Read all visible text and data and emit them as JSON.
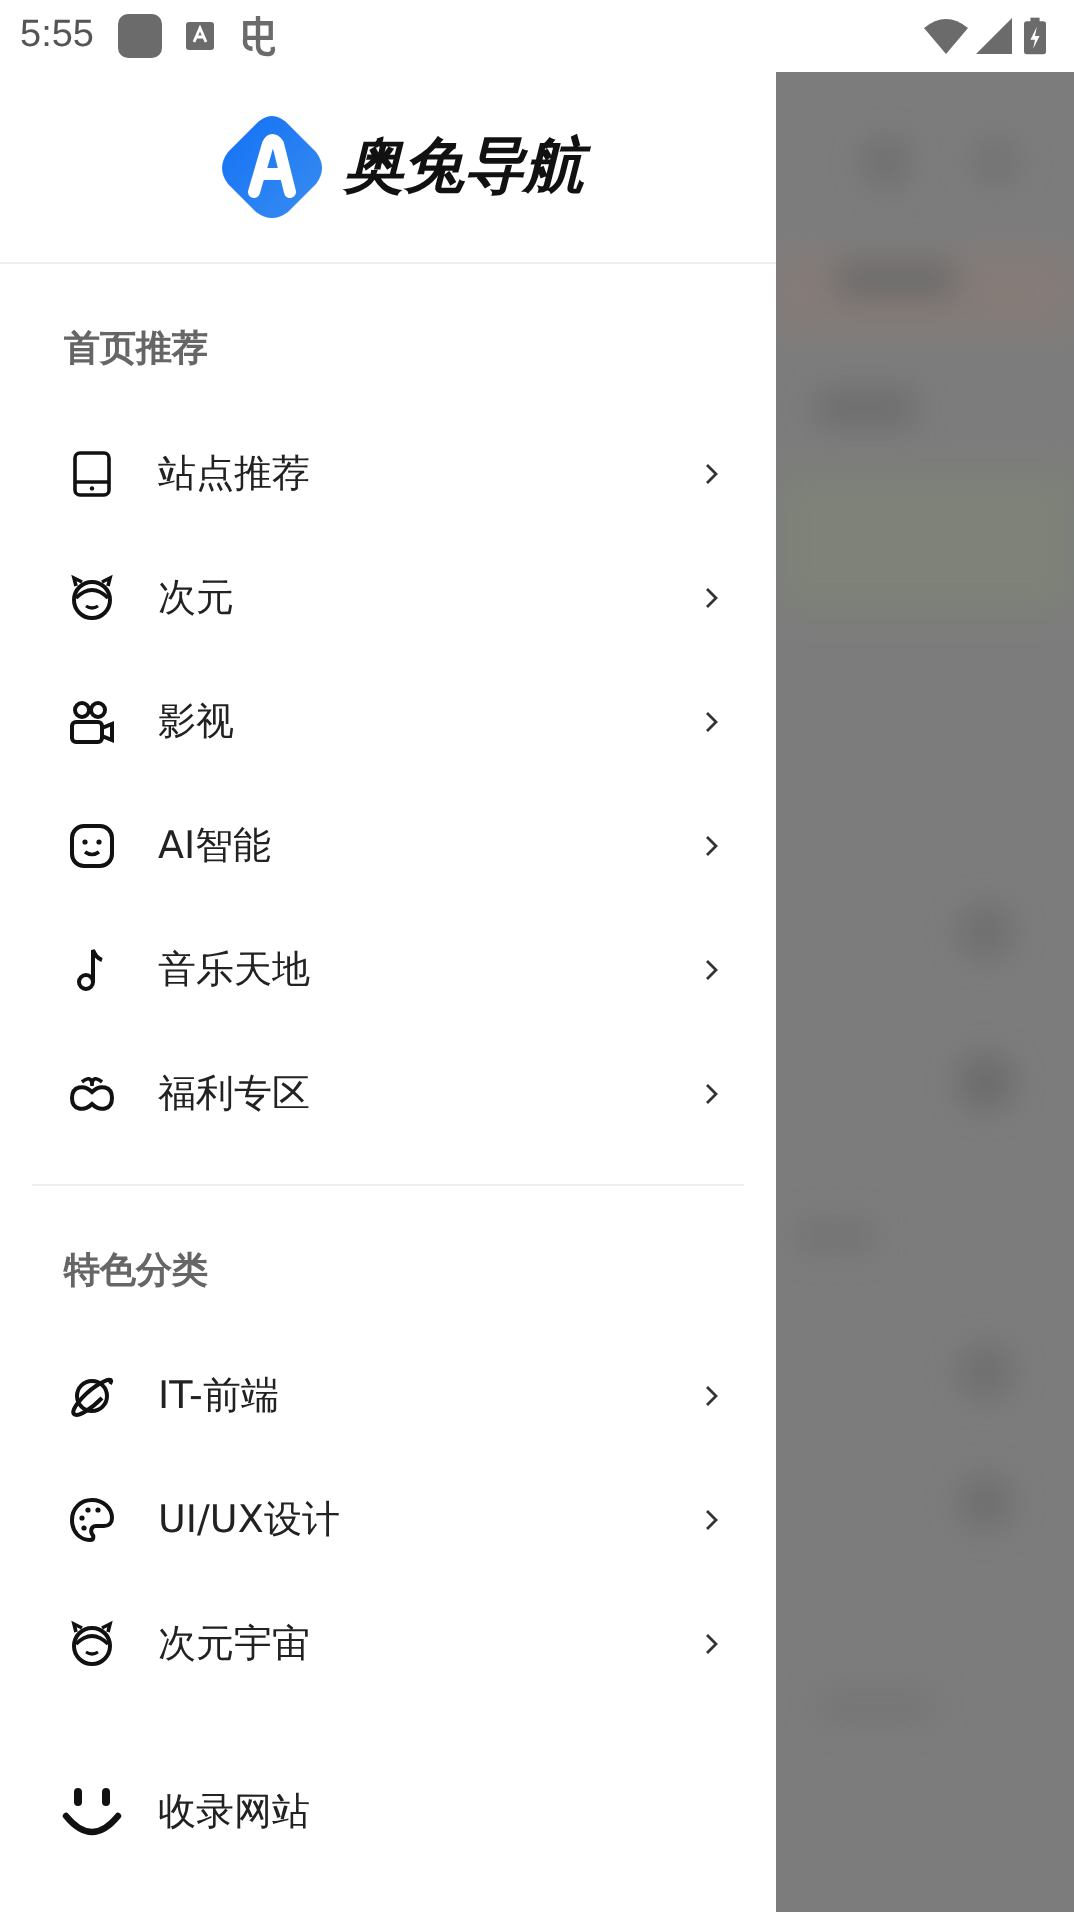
{
  "status_bar": {
    "time": "5:55"
  },
  "drawer": {
    "app_name": "奥兔导航",
    "sections": [
      {
        "title": "首页推荐",
        "items": [
          {
            "label": "站点推荐",
            "kind": "tablet"
          },
          {
            "label": "次元",
            "kind": "girl"
          },
          {
            "label": "影视",
            "kind": "camera"
          },
          {
            "label": "AI智能",
            "kind": "robot"
          },
          {
            "label": "音乐天地",
            "kind": "note"
          },
          {
            "label": "福利专区",
            "kind": "gift"
          }
        ]
      },
      {
        "title": "特色分类",
        "items": [
          {
            "label": "IT-前端",
            "kind": "planet"
          },
          {
            "label": "UI/UX设计",
            "kind": "palette"
          },
          {
            "label": "次元宇宙",
            "kind": "girl"
          }
        ]
      }
    ],
    "footer_item": {
      "label": "收录网站"
    }
  }
}
